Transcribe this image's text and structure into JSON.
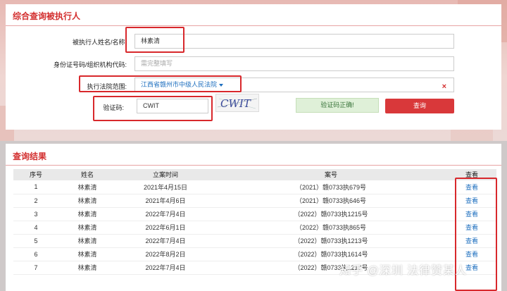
{
  "query_panel": {
    "title": "综合查询被执行人",
    "fields": {
      "name_label": "被执行人姓名/名称:",
      "name_value": "林素清",
      "id_label": "身份证号码/组织机构代码:",
      "id_placeholder": "需完整填写",
      "court_label": "执行法院范围:",
      "court_value": "江西省赣州市中级人民法院",
      "captcha_label": "验证码:",
      "captcha_value": "CWIT",
      "captcha_image_text": "CWIT"
    },
    "captcha_ok": "验证码正确!",
    "query_button": "查询",
    "clear_icon": "×"
  },
  "results_panel": {
    "title": "查询结果",
    "headers": [
      "序号",
      "姓名",
      "立案时间",
      "案号",
      "查看"
    ],
    "rows": [
      {
        "no": "1",
        "name": "林素清",
        "date": "2021年4月15日",
        "case": "（2021）赣0733执679号",
        "view": "查看"
      },
      {
        "no": "2",
        "name": "林素清",
        "date": "2021年4月6日",
        "case": "（2021）赣0733执646号",
        "view": "查看"
      },
      {
        "no": "3",
        "name": "林素清",
        "date": "2022年7月4日",
        "case": "（2022）赣0733执1215号",
        "view": "查看"
      },
      {
        "no": "4",
        "name": "林素清",
        "date": "2022年6月1日",
        "case": "（2022）赣0733执865号",
        "view": "查看"
      },
      {
        "no": "5",
        "name": "林素清",
        "date": "2022年7月4日",
        "case": "（2022）赣0733执1213号",
        "view": "查看"
      },
      {
        "no": "6",
        "name": "林素清",
        "date": "2022年8月2日",
        "case": "（2022）赣0733执1614号",
        "view": "查看"
      },
      {
        "no": "7",
        "name": "林素清",
        "date": "2022年7月4日",
        "case": "（2022）赣0733执1217号",
        "view": "查看"
      }
    ]
  },
  "watermark": "知乎 @深圳 法律赞某人",
  "colors": {
    "accent_red": "#d32f2f",
    "link_blue": "#1e6fbf",
    "success_green_bg": "#dff0d8",
    "highlight_box": "#d8282c"
  }
}
